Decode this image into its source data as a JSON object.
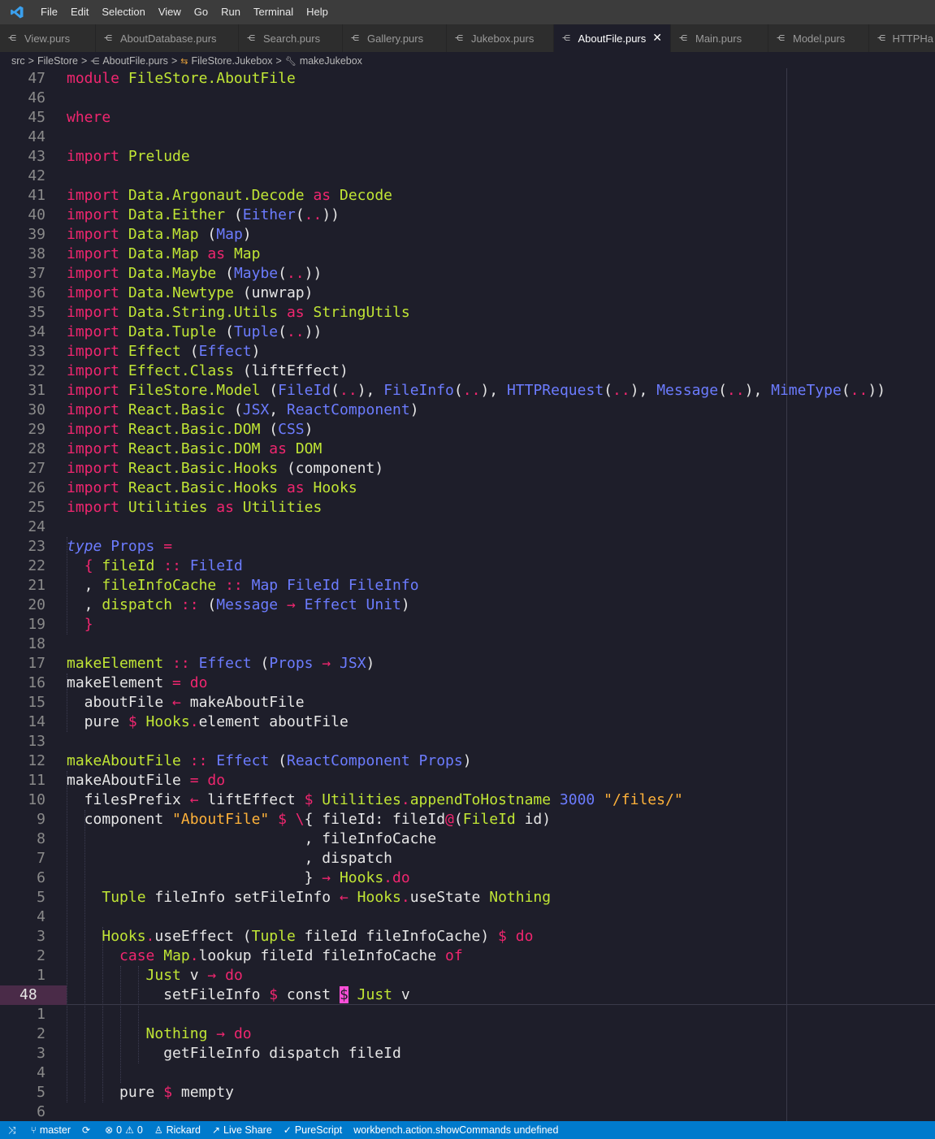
{
  "menu": [
    "File",
    "Edit",
    "Selection",
    "View",
    "Go",
    "Run",
    "Terminal",
    "Help"
  ],
  "tabs": [
    {
      "label": "View.purs",
      "active": false
    },
    {
      "label": "AboutDatabase.purs",
      "active": false
    },
    {
      "label": "Search.purs",
      "active": false
    },
    {
      "label": "Gallery.purs",
      "active": false
    },
    {
      "label": "Jukebox.purs",
      "active": false
    },
    {
      "label": "AboutFile.purs",
      "active": true
    },
    {
      "label": "Main.purs",
      "active": false
    },
    {
      "label": "Model.purs",
      "active": false
    },
    {
      "label": "HTTPHa",
      "active": false
    }
  ],
  "breadcrumb": {
    "src": "src",
    "folder": "FileStore",
    "file": "AboutFile.purs",
    "module": "FileStore.Jukebox",
    "symbol": "makeJukebox"
  },
  "editor": {
    "lines": [
      {
        "ln": "47",
        "code": "<span class=\"kw\">module</span> <span class=\"mod\">FileStore.AboutFile</span>"
      },
      {
        "ln": "46",
        "code": ""
      },
      {
        "ln": "45",
        "code": "<span class=\"kw\">where</span>"
      },
      {
        "ln": "44",
        "code": ""
      },
      {
        "ln": "43",
        "code": "<span class=\"kw\">import</span> <span class=\"mod\">Prelude</span>"
      },
      {
        "ln": "42",
        "code": ""
      },
      {
        "ln": "41",
        "code": "<span class=\"kw\">import</span> <span class=\"mod\">Data.Argonaut.Decode</span> <span class=\"kw\">as</span> <span class=\"mod\">Decode</span>"
      },
      {
        "ln": "40",
        "code": "<span class=\"kw\">import</span> <span class=\"mod\">Data.Either</span> (<span class=\"ty\">Either</span>(<span class=\"op\">..</span>))"
      },
      {
        "ln": "39",
        "code": "<span class=\"kw\">import</span> <span class=\"mod\">Data.Map</span> (<span class=\"ty\">Map</span>)"
      },
      {
        "ln": "38",
        "code": "<span class=\"kw\">import</span> <span class=\"mod\">Data.Map</span> <span class=\"kw\">as</span> <span class=\"mod\">Map</span>"
      },
      {
        "ln": "37",
        "code": "<span class=\"kw\">import</span> <span class=\"mod\">Data.Maybe</span> (<span class=\"ty\">Maybe</span>(<span class=\"op\">..</span>))"
      },
      {
        "ln": "36",
        "code": "<span class=\"kw\">import</span> <span class=\"mod\">Data.Newtype</span> (unwrap)"
      },
      {
        "ln": "35",
        "code": "<span class=\"kw\">import</span> <span class=\"mod\">Data.String.Utils</span> <span class=\"kw\">as</span> <span class=\"mod\">StringUtils</span>"
      },
      {
        "ln": "34",
        "code": "<span class=\"kw\">import</span> <span class=\"mod\">Data.Tuple</span> (<span class=\"ty\">Tuple</span>(<span class=\"op\">..</span>))"
      },
      {
        "ln": "33",
        "code": "<span class=\"kw\">import</span> <span class=\"mod\">Effect</span> (<span class=\"ty\">Effect</span>)"
      },
      {
        "ln": "32",
        "code": "<span class=\"kw\">import</span> <span class=\"mod\">Effect.Class</span> (liftEffect)"
      },
      {
        "ln": "31",
        "code": "<span class=\"kw\">import</span> <span class=\"mod\">FileStore.Model</span> (<span class=\"ty\">FileId</span>(<span class=\"op\">..</span>), <span class=\"ty\">FileInfo</span>(<span class=\"op\">..</span>), <span class=\"ty\">HTTPRequest</span>(<span class=\"op\">..</span>), <span class=\"ty\">Message</span>(<span class=\"op\">..</span>), <span class=\"ty\">MimeType</span>(<span class=\"op\">..</span>))"
      },
      {
        "ln": "30",
        "code": "<span class=\"kw\">import</span> <span class=\"mod\">React.Basic</span> (<span class=\"ty\">JSX</span>, <span class=\"ty\">ReactComponent</span>)"
      },
      {
        "ln": "29",
        "code": "<span class=\"kw\">import</span> <span class=\"mod\">React.Basic.DOM</span> (<span class=\"ty\">CSS</span>)"
      },
      {
        "ln": "28",
        "code": "<span class=\"kw\">import</span> <span class=\"mod\">React.Basic.DOM</span> <span class=\"kw\">as</span> <span class=\"mod\">DOM</span>"
      },
      {
        "ln": "27",
        "code": "<span class=\"kw\">import</span> <span class=\"mod\">React.Basic.Hooks</span> (component)"
      },
      {
        "ln": "26",
        "code": "<span class=\"kw\">import</span> <span class=\"mod\">React.Basic.Hooks</span> <span class=\"kw\">as</span> <span class=\"mod\">Hooks</span>"
      },
      {
        "ln": "25",
        "code": "<span class=\"kw\">import</span> <span class=\"mod\">Utilities</span> <span class=\"kw\">as</span> <span class=\"mod\">Utilities</span>"
      },
      {
        "ln": "24",
        "code": ""
      },
      {
        "ln": "23",
        "code": "<span class=\"it\">type</span> <span class=\"ty\">Props</span> <span class=\"op\">=</span>"
      },
      {
        "ln": "22",
        "code": "  <span class=\"op\">{</span> <span class=\"mod\">fileId</span> <span class=\"op\">::</span> <span class=\"ty\">FileId</span>"
      },
      {
        "ln": "21",
        "code": "  , <span class=\"mod\">fileInfoCache</span> <span class=\"op\">::</span> <span class=\"ty\">Map</span> <span class=\"ty\">FileId</span> <span class=\"ty\">FileInfo</span>"
      },
      {
        "ln": "20",
        "code": "  , <span class=\"mod\">dispatch</span> <span class=\"op\">::</span> (<span class=\"ty\">Message</span> <span class=\"op\">→</span> <span class=\"ty\">Effect</span> <span class=\"ty\">Unit</span>)"
      },
      {
        "ln": "19",
        "code": "  <span class=\"op\">}</span>"
      },
      {
        "ln": "18",
        "code": ""
      },
      {
        "ln": "17",
        "code": "<span class=\"mod\">makeElement</span> <span class=\"op\">::</span> <span class=\"ty\">Effect</span> (<span class=\"ty\">Props</span> <span class=\"op\">→</span> <span class=\"ty\">JSX</span>)"
      },
      {
        "ln": "16",
        "code": "makeElement <span class=\"op\">=</span> <span class=\"kw\">do</span>"
      },
      {
        "ln": "15",
        "code": "  aboutFile <span class=\"op\">←</span> makeAboutFile"
      },
      {
        "ln": "14",
        "code": "  pure <span class=\"op\">$</span> <span class=\"mod\">Hooks</span><span class=\"op\">.</span>element aboutFile"
      },
      {
        "ln": "13",
        "code": ""
      },
      {
        "ln": "12",
        "code": "<span class=\"mod\">makeAboutFile</span> <span class=\"op\">::</span> <span class=\"ty\">Effect</span> (<span class=\"ty\">ReactComponent</span> <span class=\"ty\">Props</span>)"
      },
      {
        "ln": "11",
        "code": "makeAboutFile <span class=\"op\">=</span> <span class=\"kw\">do</span>"
      },
      {
        "ln": "10",
        "code": "  filesPrefix <span class=\"op\">←</span> liftEffect <span class=\"op\">$</span> <span class=\"mod\">Utilities</span><span class=\"op\">.</span><span class=\"mod\">appendToHostname</span> <span class=\"num\">3000</span> <span class=\"str\">\"/files/\"</span>"
      },
      {
        "ln": "9",
        "code": "  component <span class=\"str\">\"AboutFile\"</span> <span class=\"op\">$</span> <span class=\"op\">\\</span>{ fileId: fileId<span class=\"op\">@</span>(<span class=\"mod\">FileId</span> id)"
      },
      {
        "ln": "8",
        "code": "                           , fileInfoCache"
      },
      {
        "ln": "7",
        "code": "                           , dispatch"
      },
      {
        "ln": "6",
        "code": "                           } <span class=\"op\">→</span> <span class=\"mod\">Hooks</span><span class=\"op\">.do</span>"
      },
      {
        "ln": "5",
        "code": "    <span class=\"mod\">Tuple</span> fileInfo setFileInfo <span class=\"op\">←</span> <span class=\"mod\">Hooks</span><span class=\"op\">.</span>useState <span class=\"mod\">Nothing</span>"
      },
      {
        "ln": "4",
        "code": ""
      },
      {
        "ln": "3",
        "code": "    <span class=\"mod\">Hooks</span><span class=\"op\">.</span>useEffect (<span class=\"mod\">Tuple</span> fileId fileInfoCache) <span class=\"op\">$</span> <span class=\"kw\">do</span>"
      },
      {
        "ln": "2",
        "code": "      <span class=\"kw\">case</span> <span class=\"mod\">Map</span><span class=\"op\">.</span>lookup fileId fileInfoCache <span class=\"kw\">of</span>"
      },
      {
        "ln": "1",
        "code": "         <span class=\"mod\">Just</span> v <span class=\"op\">→</span> <span class=\"kw\">do</span>"
      },
      {
        "ln": "48",
        "code": "           setFileInfo <span class=\"op\">$</span> const <span class=\"hl\">$</span> <span class=\"mod\">Just</span> v",
        "current": true
      },
      {
        "ln": "1",
        "code": ""
      },
      {
        "ln": "2",
        "code": "         <span class=\"mod\">Nothing</span> <span class=\"op\">→</span> <span class=\"kw\">do</span>"
      },
      {
        "ln": "3",
        "code": "           getFileInfo dispatch fileId"
      },
      {
        "ln": "4",
        "code": ""
      },
      {
        "ln": "5",
        "code": "      pure <span class=\"op\">$</span> mempty"
      },
      {
        "ln": "6",
        "code": ""
      }
    ]
  },
  "status": {
    "branch": "master",
    "errors": "0",
    "warnings": "0",
    "user": "Rickard",
    "live_share": "Live Share",
    "language": "PureScript",
    "message": "workbench.action.showCommands undefined"
  },
  "colors": {
    "menubar": "#3c3c3c",
    "editor_bg": "#1e1e2a",
    "statusbar": "#007acc",
    "keyword": "#f0266f",
    "module": "#c0e535",
    "type": "#6c7cff",
    "string": "#ffb23a"
  }
}
